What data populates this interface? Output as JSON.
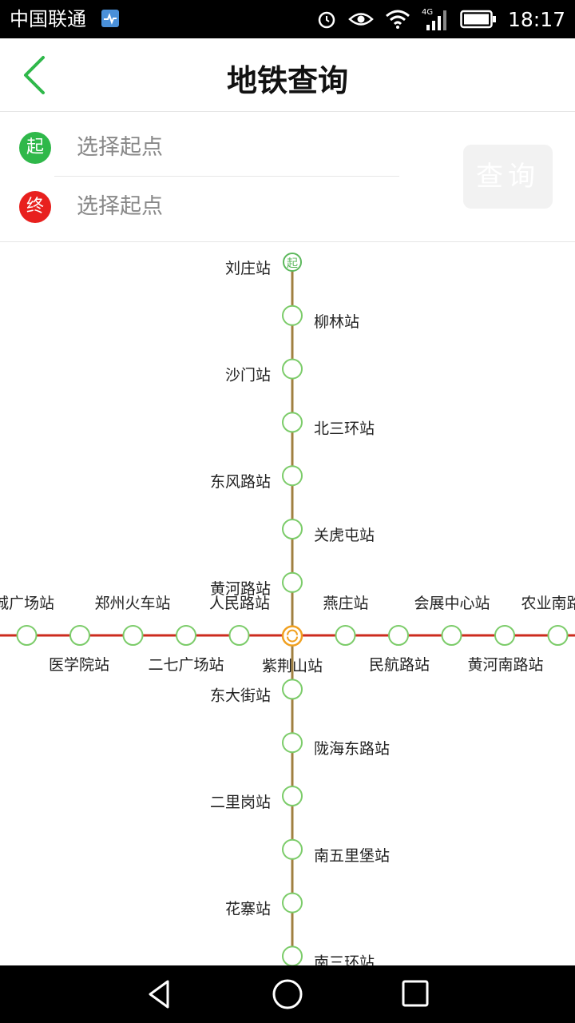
{
  "status_bar": {
    "carrier": "中国联通",
    "time": "18:17",
    "network": "4G",
    "icons": [
      "health-app-icon",
      "alarm-icon",
      "eye-icon",
      "wifi-icon",
      "signal-icon",
      "battery-icon"
    ]
  },
  "header": {
    "title": "地铁查询",
    "back_icon": "chevron-left-icon"
  },
  "search": {
    "start_badge": "起",
    "end_badge": "终",
    "start_placeholder": "选择起点",
    "end_placeholder": "选择起点",
    "query_button": "查询"
  },
  "map": {
    "colors": {
      "vertical_line": "#a08040",
      "horizontal_line": "#cc2b1e",
      "station_ring": "#7ccc6a",
      "start_marker": "#5cb85c",
      "transfer_marker": "#f0a020"
    },
    "start_marker_text": "起",
    "vertical_line": {
      "stations": [
        "刘庄站",
        "柳林站",
        "沙门站",
        "北三环站",
        "东风路站",
        "关虎屯站",
        "黄河路站",
        "紫荆山站",
        "东大街站",
        "陇海东路站",
        "二里岗站",
        "南五里堡站",
        "花寨站",
        "南三环站"
      ]
    },
    "horizontal_line": {
      "stations_above": [
        "城广场站",
        "郑州火车站",
        "人民路站",
        "燕庄站",
        "会展中心站",
        "农业南路站"
      ],
      "stations_below": [
        "医学院站",
        "二七广场站",
        "紫荆山站",
        "民航路站",
        "黄河南路站"
      ],
      "transfer_station": "紫荆山站"
    }
  },
  "nav_bar": {
    "buttons": [
      "back-triangle-icon",
      "home-circle-icon",
      "recents-square-icon"
    ]
  }
}
